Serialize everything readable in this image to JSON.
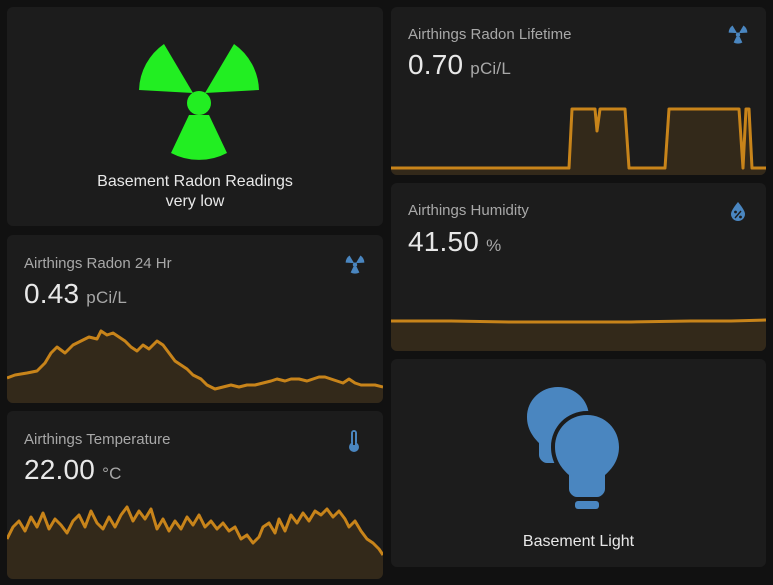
{
  "colors": {
    "background": "#111111",
    "card": "#1c1c1c",
    "accent_line": "#c8841a",
    "accent_fill": "#33291a",
    "icon_blue": "#4a86c0",
    "radiation_green": "#22ee22"
  },
  "radon_status_card": {
    "icon": "radioactive-icon",
    "name": "Basement Radon Readings",
    "state": "very low"
  },
  "radon_24hr_card": {
    "title": "Airthings Radon 24 Hr",
    "value": "0.43",
    "unit": "pCi/L",
    "icon": "radioactive-icon"
  },
  "temperature_card": {
    "title": "Airthings Temperature",
    "value": "22.00",
    "unit": "°C",
    "icon": "thermometer-icon"
  },
  "radon_lifetime_card": {
    "title": "Airthings Radon Lifetime",
    "value": "0.70",
    "unit": "pCi/L",
    "icon": "radioactive-icon"
  },
  "humidity_card": {
    "title": "Airthings Humidity",
    "value": "41.50",
    "unit": "%",
    "icon": "water-percent-icon"
  },
  "light_card": {
    "name": "Basement Light",
    "icon": "lightbulb-group-icon"
  }
}
